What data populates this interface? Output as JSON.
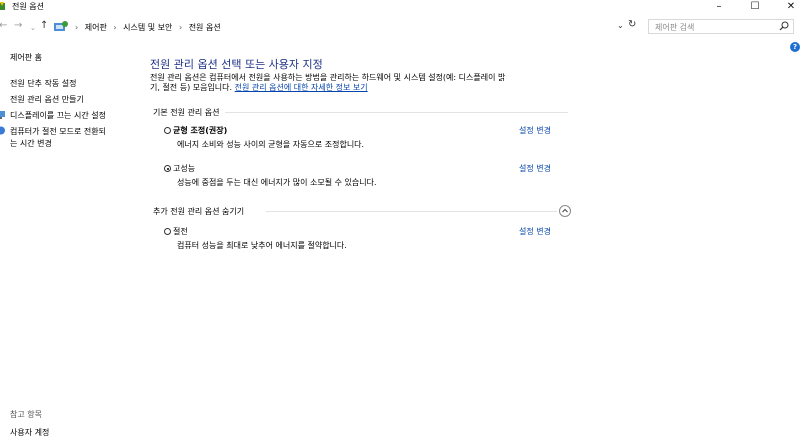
{
  "window": {
    "title": "전원 옵션",
    "minimize": "–",
    "maximize": "☐",
    "close": "✕"
  },
  "nav": {
    "back": "←",
    "forward": "→",
    "recent": "⌄",
    "up": "↑",
    "breadcrumb": [
      "제어판",
      "시스템 및 보안",
      "전원 옵션"
    ],
    "separator": "›",
    "dropdown": "⌄",
    "refresh": "↻",
    "search_placeholder": "제어판 검색"
  },
  "sidebar": {
    "home": "제어판 홈",
    "items": [
      "전원 단추 작동 설정",
      "전원 관리 옵션 만들기",
      "디스플레이를 끄는 시간 설정",
      "컴퓨터가 절전 모드로 전환되",
      "는 시간 변경"
    ],
    "see_also": "참고 항목",
    "user_accounts": "사용자 계정"
  },
  "help": "?",
  "main": {
    "title": "전원 관리 옵션 선택 또는 사용자 지정",
    "desc_line1": "전원 관리 옵션은 컴퓨터에서 전원을 사용하는 방법을 관리하는 하드웨어 및 시스템 설정(예: 디스플레이 밝",
    "desc_line2": "기, 절전 등) 모음입니다. ",
    "desc_link": "전원 관리 옵션에 대한 자세한 정보 보기",
    "basic_heading": "기본 전원 관리 옵션",
    "extra_heading": "추가 전원 관리 옵션 숨기기",
    "change_label": "설정 변경",
    "plans": [
      {
        "name": "균형 조정(권장)",
        "desc": "에너지 소비와 성능 사이의 균형을 자동으로 조정합니다.",
        "selected": false
      },
      {
        "name": "고성능",
        "desc": "성능에 중점을 두는 대신 에너지가 많이 소모될 수 있습니다.",
        "selected": true
      },
      {
        "name": "절전",
        "desc": "컴퓨터 성능을 최대로 낮추어 에너지를 절약합니다.",
        "selected": false
      }
    ]
  },
  "colors": {
    "title": "#1e3287",
    "link": "#0645ad",
    "help": "#1f6fd1"
  }
}
